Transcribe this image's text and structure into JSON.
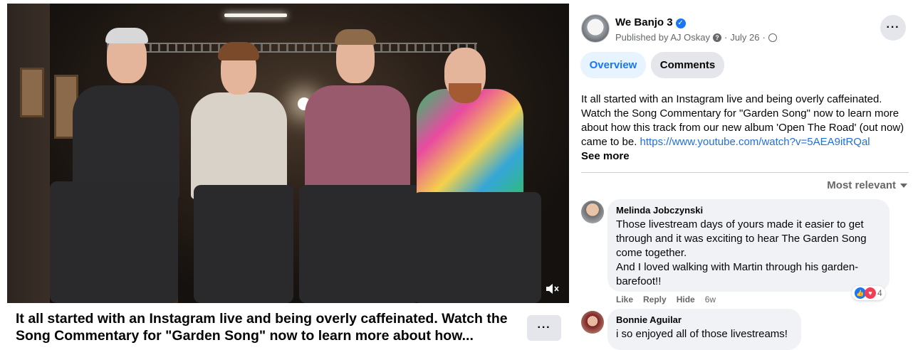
{
  "video": {
    "caption": "It all started with an Instagram live and being overly caffeinated. Watch the Song Commentary for \"Garden Song\" now to learn more about how...",
    "more_label": "···"
  },
  "post": {
    "page_name": "We Banjo 3",
    "published_by": "Published by AJ Oskay",
    "date": "July 26",
    "separator": "·",
    "more_label": "···"
  },
  "tabs": [
    {
      "label": "Overview"
    },
    {
      "label": "Comments"
    }
  ],
  "description": {
    "text": "It all started with an Instagram live and being overly caffeinated. Watch the Song Commentary for \"Garden Song\" now to learn more about how this track from our new album 'Open The Road' (out now) came to be. ",
    "link": "https://www.youtube.com/watch?v=5AEA9itRQal",
    "see_more": "See more"
  },
  "sort": {
    "label": "Most relevant"
  },
  "comments": [
    {
      "author": "Melinda Jobczynski",
      "lines": [
        "Those livestream days of yours made it easier to get through and it was exciting to hear The Garden Song come together.",
        "And I loved walking with Martin through his garden-barefoot!!"
      ],
      "actions": [
        "Like",
        "Reply",
        "Hide"
      ],
      "time": "6w",
      "reaction_count": "4"
    },
    {
      "author": "Bonnie Aguilar",
      "lines": [
        "i so enjoyed all of those livestreams!"
      ]
    }
  ],
  "colors": {
    "accent": "#1877f2",
    "link": "#216fdb",
    "muted": "#65676b",
    "bubble": "#f0f2f5"
  }
}
